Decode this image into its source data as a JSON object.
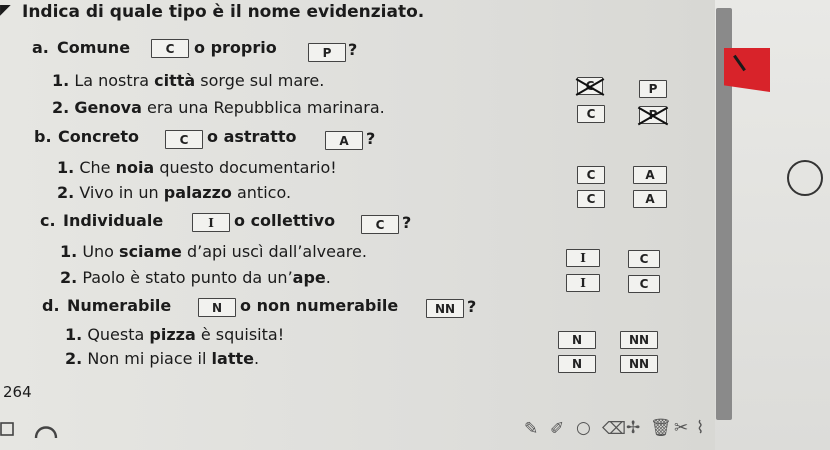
{
  "heading": "Indica di quale tipo è il nome evidenziato.",
  "sections": {
    "a": {
      "letter": "a.",
      "label1": "Comune",
      "box1": "C",
      "middle": "o proprio",
      "box2": "P",
      "end": "?",
      "items": [
        {
          "num": "1.",
          "pre": "La nostra ",
          "bold": "città",
          "post": " sorge sul mare.",
          "opt1": "C",
          "opt2": "P"
        },
        {
          "num": "2.",
          "pre": "",
          "bold": "Genova",
          "post": " era una Repubblica marinara.",
          "opt1": "C",
          "opt2": "P"
        }
      ]
    },
    "b": {
      "letter": "b.",
      "label1": "Concreto",
      "box1": "C",
      "middle": "o astratto",
      "box2": "A",
      "end": "?",
      "items": [
        {
          "num": "1.",
          "pre": "Che ",
          "bold": "noia",
          "post": " questo documentario!",
          "opt1": "C",
          "opt2": "A"
        },
        {
          "num": "2.",
          "pre": "Vivo in un ",
          "bold": "palazzo",
          "post": " antico.",
          "opt1": "C",
          "opt2": "A"
        }
      ]
    },
    "c": {
      "letter": "c.",
      "label1": "Individuale",
      "box1": "I",
      "middle": "o collettivo",
      "box2": "C",
      "end": "?",
      "items": [
        {
          "num": "1.",
          "pre": "Uno ",
          "bold": "sciame",
          "post": " d’api uscì dall’alveare.",
          "opt1": "I",
          "opt2": "C"
        },
        {
          "num": "2.",
          "pre": "Paolo è stato punto da un’",
          "bold": "ape",
          "post": ".",
          "opt1": "I",
          "opt2": "C"
        }
      ]
    },
    "d": {
      "letter": "d.",
      "label1": "Numerabile",
      "box1": "N",
      "middle": "o non numerabile",
      "box2": "NN",
      "end": "?",
      "items": [
        {
          "num": "1.",
          "pre": "Questa ",
          "bold": "pizza",
          "post": " è squisita!",
          "opt1": "N",
          "opt2": "NN"
        },
        {
          "num": "2.",
          "pre": "Non mi piace il ",
          "bold": "latte",
          "post": ".",
          "opt1": "N",
          "opt2": "NN"
        }
      ]
    }
  },
  "page_number": "264",
  "colors": {
    "accent": "#d8232a",
    "scrollbar": "#8a8a8a"
  },
  "toolbar_icons": [
    "pen-icon",
    "highlighter-icon",
    "circle-icon",
    "eraser-icon",
    "plus-icon",
    "trash-icon",
    "scissors-icon",
    "lasso-icon"
  ]
}
